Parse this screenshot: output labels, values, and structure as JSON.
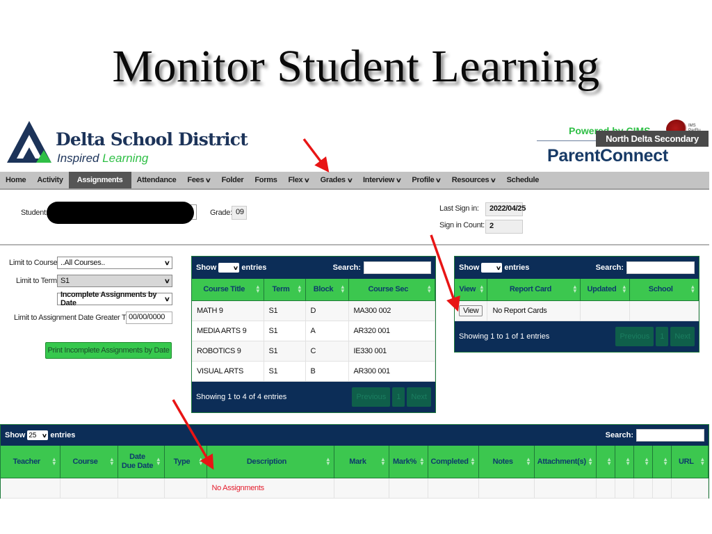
{
  "slide": {
    "title": "Monitor Student Learning"
  },
  "header": {
    "district_name": "Delta School District",
    "tagline_part1": "Inspired ",
    "tagline_part2": "Learning",
    "powered_by": "Powered by CIMS",
    "school": "North Delta Secondary",
    "app_name": "ParentConnect",
    "colors": {
      "navy": "#1c3359",
      "green": "#2fbf46"
    }
  },
  "nav": {
    "items": [
      {
        "label": "Home",
        "dropdown": false,
        "active": false
      },
      {
        "label": "Activity",
        "dropdown": false,
        "active": false
      },
      {
        "label": "Assignments",
        "dropdown": false,
        "active": true
      },
      {
        "label": "Attendance",
        "dropdown": false,
        "active": false
      },
      {
        "label": "Fees",
        "dropdown": true,
        "active": false
      },
      {
        "label": "Folder",
        "dropdown": false,
        "active": false
      },
      {
        "label": "Forms",
        "dropdown": false,
        "active": false
      },
      {
        "label": "Flex",
        "dropdown": true,
        "active": false
      },
      {
        "label": "Grades",
        "dropdown": true,
        "active": false
      },
      {
        "label": "Interview",
        "dropdown": true,
        "active": false
      },
      {
        "label": "Profile",
        "dropdown": true,
        "active": false
      },
      {
        "label": "Resources",
        "dropdown": true,
        "active": false
      },
      {
        "label": "Schedule",
        "dropdown": false,
        "active": false
      }
    ],
    "chevron": "∨"
  },
  "student_info": {
    "student_label": "Student:",
    "student_value": "[redacted]",
    "grade_label": "Grade:",
    "grade_value": "09",
    "last_sign_in_label": "Last Sign in:",
    "last_sign_in_value": "2022/04/25",
    "sign_in_count_label": "Sign in Count:",
    "sign_in_count_value": "2"
  },
  "filters": {
    "course_label": "Limit to Course:",
    "course_value": "..All Courses..",
    "term_label": "Limit to Term:",
    "term_value": "S1",
    "report_value": "Incomplete Assignments by Date",
    "date_label": "Limit to Assignment Date Greater Than:",
    "date_value": "00/00/0000",
    "print_button": "Print Incomplete Assignments by Date",
    "select_arrow": "∨"
  },
  "courses_table": {
    "show_label": "Show",
    "entries_label": "entries",
    "show_value": "",
    "search_label": "Search:",
    "columns": [
      "Course Title",
      "Term",
      "Block",
      "Course Sec"
    ],
    "rows": [
      [
        "MATH 9",
        "S1",
        "D",
        "MA300 002"
      ],
      [
        "MEDIA ARTS 9",
        "S1",
        "A",
        "AR320 001"
      ],
      [
        "ROBOTICS 9",
        "S1",
        "C",
        "IE330 001"
      ],
      [
        "VISUAL ARTS",
        "S1",
        "B",
        "AR300 001"
      ]
    ],
    "info": "Showing 1 to 4 of 4 entries",
    "pager": {
      "previous": "Previous",
      "page": "1",
      "next": "Next"
    }
  },
  "report_table": {
    "show_label": "Show",
    "entries_label": "entries",
    "show_value": "",
    "search_label": "Search:",
    "columns": [
      "View",
      "Report Card",
      "Updated",
      "School"
    ],
    "row": {
      "view_button": "View",
      "report_card": "No Report Cards",
      "updated": "",
      "school": ""
    },
    "info": "Showing 1 to 1 of 1 entries",
    "pager": {
      "previous": "Previous",
      "page": "1",
      "next": "Next"
    }
  },
  "assignments_table": {
    "show_label": "Show",
    "show_value": "25",
    "entries_label": "entries",
    "search_label": "Search:",
    "columns": [
      "Teacher",
      "Course",
      "Date\nDue Date",
      "Type",
      "Description",
      "Mark",
      "Mark%",
      "Completed",
      "Notes",
      "Attachment(s)",
      "",
      "",
      "",
      "",
      "URL"
    ],
    "empty_message": "No Assignments"
  },
  "annotations": {
    "arrow_color": "#e81515",
    "arrow_targets": [
      "Grades menu",
      "Report card View button",
      "Assignments Description column"
    ]
  }
}
